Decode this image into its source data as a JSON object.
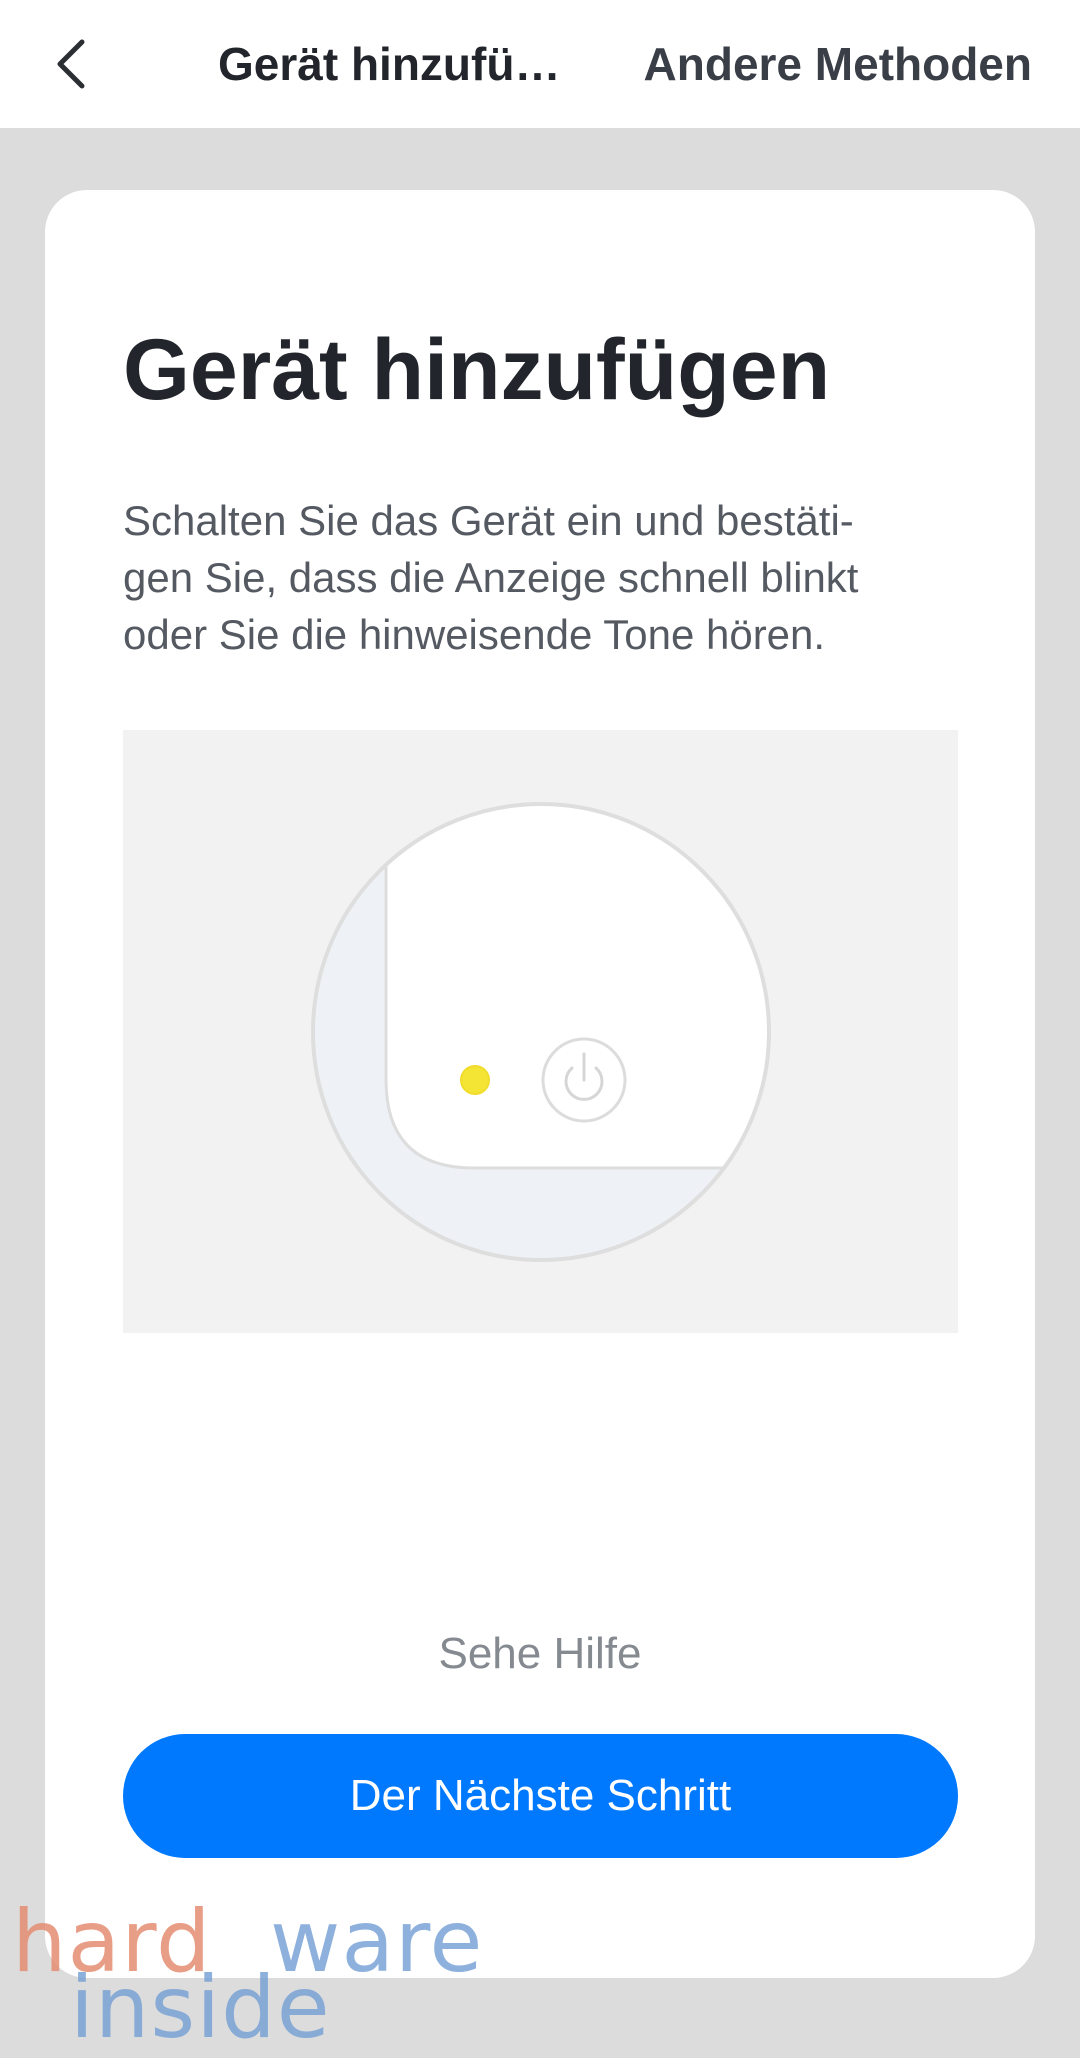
{
  "header": {
    "title": "Gerät hinzufügen",
    "right_action": "Andere Methoden"
  },
  "card": {
    "heading": "Gerät hinzufügen",
    "description": "Schalten Sie das Gerät ein und bestäti-gen Sie, dass die Anzeige schnell blinkt oder Sie die hinweisende Tone hören.",
    "description_lines": [
      "Schalten Sie das Gerät ein und bestäti-",
      "gen Sie, dass die Anzeige schnell blinkt",
      "oder Sie die hinweisende Tone hören."
    ],
    "help_link": "Sehe Hilfe",
    "next_button": "Der Nächste Schritt"
  },
  "illustration": {
    "indicator_color": "#f4e534",
    "icons": [
      "power-icon"
    ]
  },
  "watermark": {
    "part1": "hard",
    "part2": "ware",
    "part3": "inside"
  },
  "colors": {
    "accent": "#0079fe",
    "page_background": "#dcdcdc",
    "card_background": "#ffffff"
  }
}
